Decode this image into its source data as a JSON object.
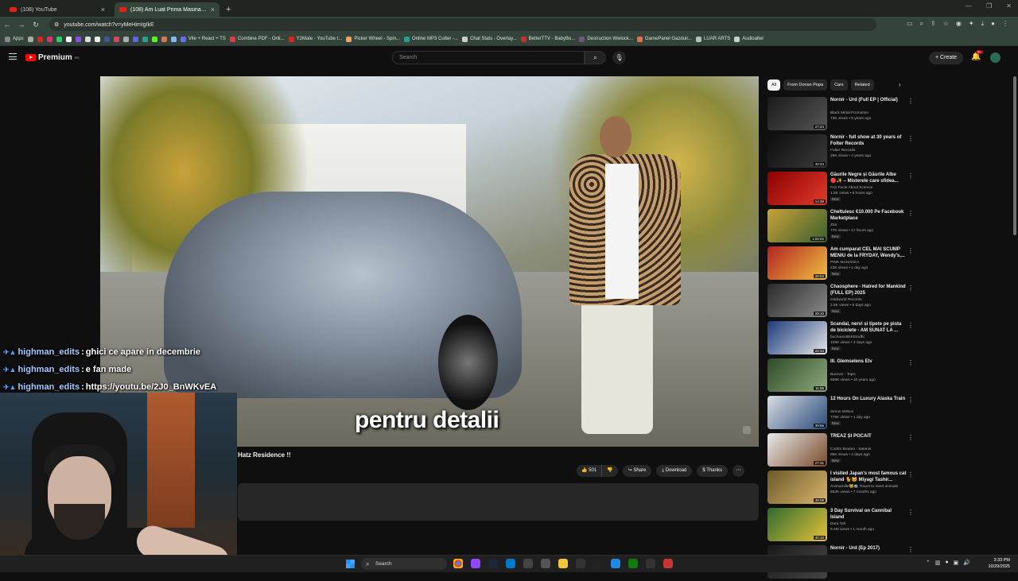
{
  "browser": {
    "tabs": [
      {
        "label": "(108) YouTube",
        "active": false
      },
      {
        "label": "(108) Am Luat Prima Masina Ele...",
        "active": true
      }
    ],
    "url": "youtube.com/watch?v=yMeHimIgIkE",
    "bookmarks": [
      "Apps",
      "Vite + React + TS",
      "Combine PDF - Onli...",
      "Y2Mate - YouTube t...",
      "Picker Wheel - Spin...",
      "Online MP3 Cutter -...",
      "Chat Stats - Overlay...",
      "BetterTTV - BabyBo...",
      "Destruction Wwlock...",
      "GamePanel Gazduir...",
      "LUAR ARTS",
      "Audioalter"
    ]
  },
  "youtube": {
    "logo_text": "Premium",
    "logo_sup": "RO",
    "search_placeholder": "Search",
    "create_label": "Create",
    "notification_count": "9+"
  },
  "player": {
    "subtitle": "pentru detalii"
  },
  "chat": [
    {
      "user": "highman_edits",
      "message": "ghici ce apare in decembrie"
    },
    {
      "user": "highman_edits",
      "message": "e fan made"
    },
    {
      "user": "highman_edits",
      "message": "https://youtu.be/2J0_BnWKvEA"
    }
  ],
  "video": {
    "title": "Hatz Residence !!",
    "likes": "501",
    "share_label": "Share",
    "download_label": "Download",
    "thanks_label": "Thanks"
  },
  "chips": [
    {
      "label": "All",
      "selected": true
    },
    {
      "label": "From Dorian Popa",
      "selected": false
    },
    {
      "label": "Cars",
      "selected": false
    },
    {
      "label": "Related",
      "selected": false
    }
  ],
  "recommendations": [
    {
      "title": "Nornir - Urd (Full EP | Official)",
      "channel": "Black Metal Promotion",
      "stats": "73K views • 8 years ago",
      "duration": "27:24",
      "new": false,
      "c1": "#1a1a1a",
      "c2": "#555555"
    },
    {
      "title": "Nornir - full show at 30 years of Folter Records",
      "channel": "Folter Records",
      "stats": "29K views • 4 years ago",
      "duration": "42:24",
      "new": false,
      "c1": "#0d0d0d",
      "c2": "#3a3a3a"
    },
    {
      "title": "Găurile Negre și Găurile Albe 🔴✨ – Misterele care sfidea...",
      "channel": "Fun Facts About Science",
      "stats": "1.5K views • 6 hours ago",
      "duration": "14:38",
      "new": true,
      "c1": "#8b0000",
      "c2": "#e23b2b"
    },
    {
      "title": "Cheltuiesc €10.000 Pe Facebook Marketplace",
      "channel": "Ztar",
      "stats": "77K views • 17 hours ago",
      "duration": "1:04:02",
      "new": true,
      "c1": "#c9a23a",
      "c2": "#3a5f2d"
    },
    {
      "title": "Am cumparat CEL MAI SCUMP MENIU de la FRYDAY, Wendy's,...",
      "channel": "PINK MANANCA",
      "stats": "23K views • 1 day ago",
      "duration": "26:53",
      "new": true,
      "c1": "#b22222",
      "c2": "#f0c040"
    },
    {
      "title": "Chaosphere - Hatred for Mankind (FULL EP) 2025",
      "channel": "Oddworld Records",
      "stats": "2.6K views • 6 days ago",
      "duration": "29:10",
      "new": true,
      "c1": "#2a2a2a",
      "c2": "#8a8a8a"
    },
    {
      "title": "Scandal, nervi și țipete pe pista de biciclete - AM SUNAT LA ...",
      "channel": "bucharestBIKEtraffic",
      "stats": "109K views • 3 days ago",
      "duration": "22:34",
      "new": true,
      "c1": "#1c3a7a",
      "c2": "#e8e8e8"
    },
    {
      "title": "III. Glemselens Elv",
      "channel": "Burzum - Topic",
      "stats": "668K views • 10 years ago",
      "duration": "11:55",
      "new": false,
      "c1": "#2e4a2a",
      "c2": "#8fa87a"
    },
    {
      "title": "12 Hours On Luxury Alaska Train",
      "channel": "Simon Wilson",
      "stats": "776K views • 1 day ago",
      "duration": "39:56",
      "new": true,
      "c1": "#d8dde2",
      "c2": "#2a4a7a"
    },
    {
      "title": "TREAZ ȘI POCĂIT",
      "channel": "Codrin Bradea · Satanis",
      "stats": "88K views • 4 days ago",
      "duration": "27:31",
      "new": true,
      "c1": "#e9e9e9",
      "c2": "#7a4a2a"
    },
    {
      "title": "I visited Japan's most famous cat island 🐈🐱 Miyagi Tashir...",
      "channel": "Animamille🐱🚢 Travel to meet animals",
      "stats": "682K views • 7 months ago",
      "duration": "49:09",
      "new": false,
      "c1": "#6a5a2a",
      "c2": "#d9b46a"
    },
    {
      "title": "3 Day Survival on Cannibal Island",
      "channel": "Dara Tah",
      "stats": "9.4M views • 1 month ago",
      "duration": "40:15",
      "new": false,
      "c1": "#2e6a2e",
      "c2": "#e6c23a"
    },
    {
      "title": "Nornir - Urd (Ep 2017)",
      "channel": "",
      "stats": "",
      "duration": "",
      "new": false,
      "c1": "#1a1a1a",
      "c2": "#444444"
    }
  ],
  "taskbar": {
    "search_label": "Search",
    "time": "3:33 PM",
    "date": "10/29/2025"
  }
}
